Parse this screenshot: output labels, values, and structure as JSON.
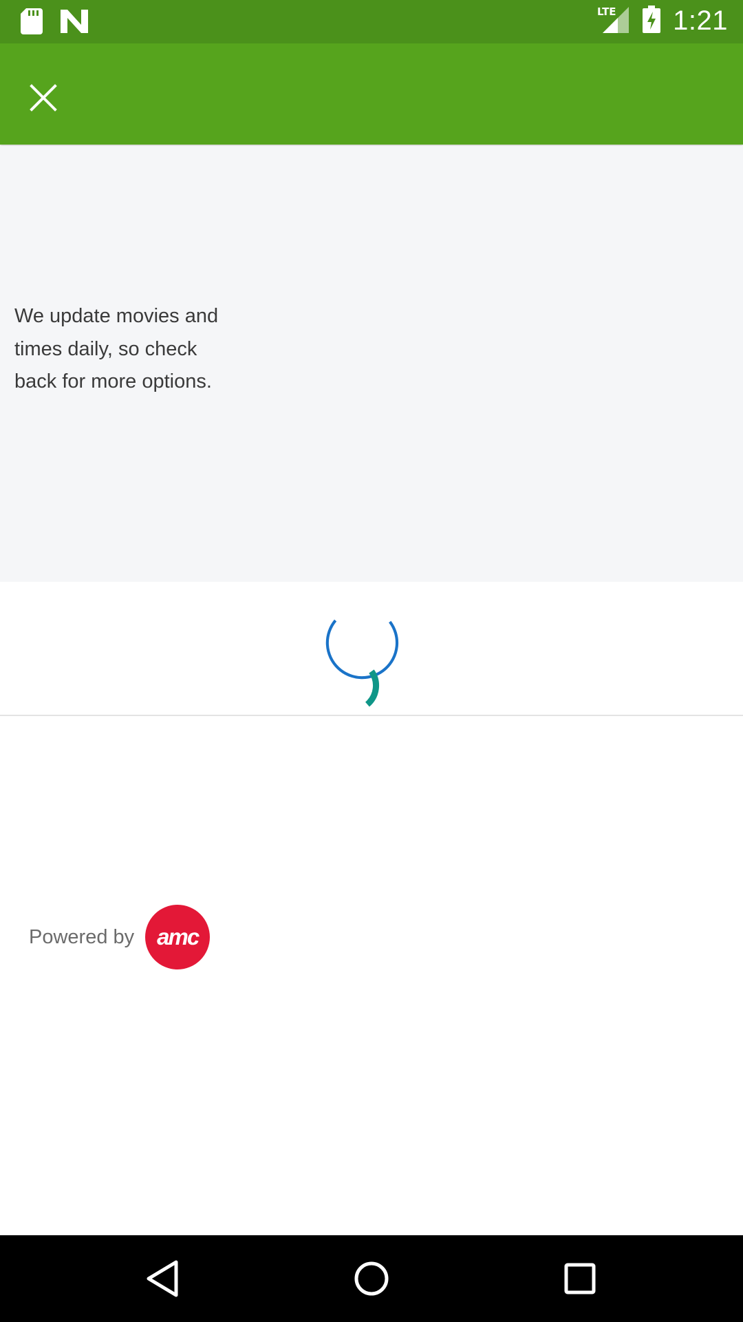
{
  "status_bar": {
    "time": "1:21",
    "network": "LTE",
    "icons": [
      "sd-card-icon",
      "n-logo-icon",
      "signal-icon",
      "battery-charging-icon"
    ]
  },
  "app_bar": {
    "close_icon": "close-icon"
  },
  "info": {
    "message": "We update movies and times daily, so check back for more options."
  },
  "loader": {
    "colors": [
      "#1a73c8",
      "#0f9688"
    ]
  },
  "footer": {
    "powered_label": "Powered by",
    "logo_text": "amc",
    "logo_color": "#e31837"
  },
  "colors": {
    "status_bar": "#4b911b",
    "app_bar": "#56a41d",
    "panel": "#f5f6f8"
  },
  "nav_bar": {
    "back_icon": "back-triangle-icon",
    "home_icon": "home-circle-icon",
    "recents_icon": "recents-square-icon"
  }
}
